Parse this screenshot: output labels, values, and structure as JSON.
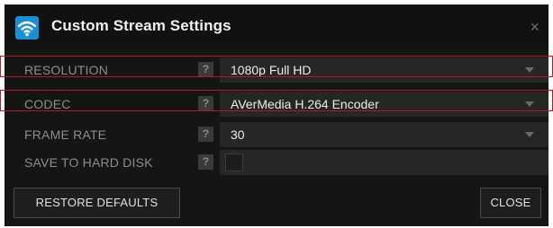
{
  "dialog": {
    "title": "Custom Stream Settings",
    "app_icon": "wifi-icon",
    "close_glyph": "×"
  },
  "rows": [
    {
      "label": "RESOLUTION",
      "help": "?",
      "value": "1080p Full HD",
      "type": "dropdown"
    },
    {
      "label": "CODEC",
      "help": "?",
      "value": "AVerMedia H.264 Encoder",
      "type": "dropdown"
    },
    {
      "label": "FRAME RATE",
      "help": "?",
      "value": "30",
      "type": "dropdown"
    },
    {
      "label": "SAVE TO HARD DISK",
      "help": "?",
      "value": "",
      "type": "checkbox",
      "checked": false
    }
  ],
  "buttons": {
    "restore_defaults": "RESTORE DEFAULTS",
    "close": "CLOSE"
  },
  "colors": {
    "accent": "#1a8fd6",
    "highlight": "#b4182b",
    "background": "#151515"
  }
}
